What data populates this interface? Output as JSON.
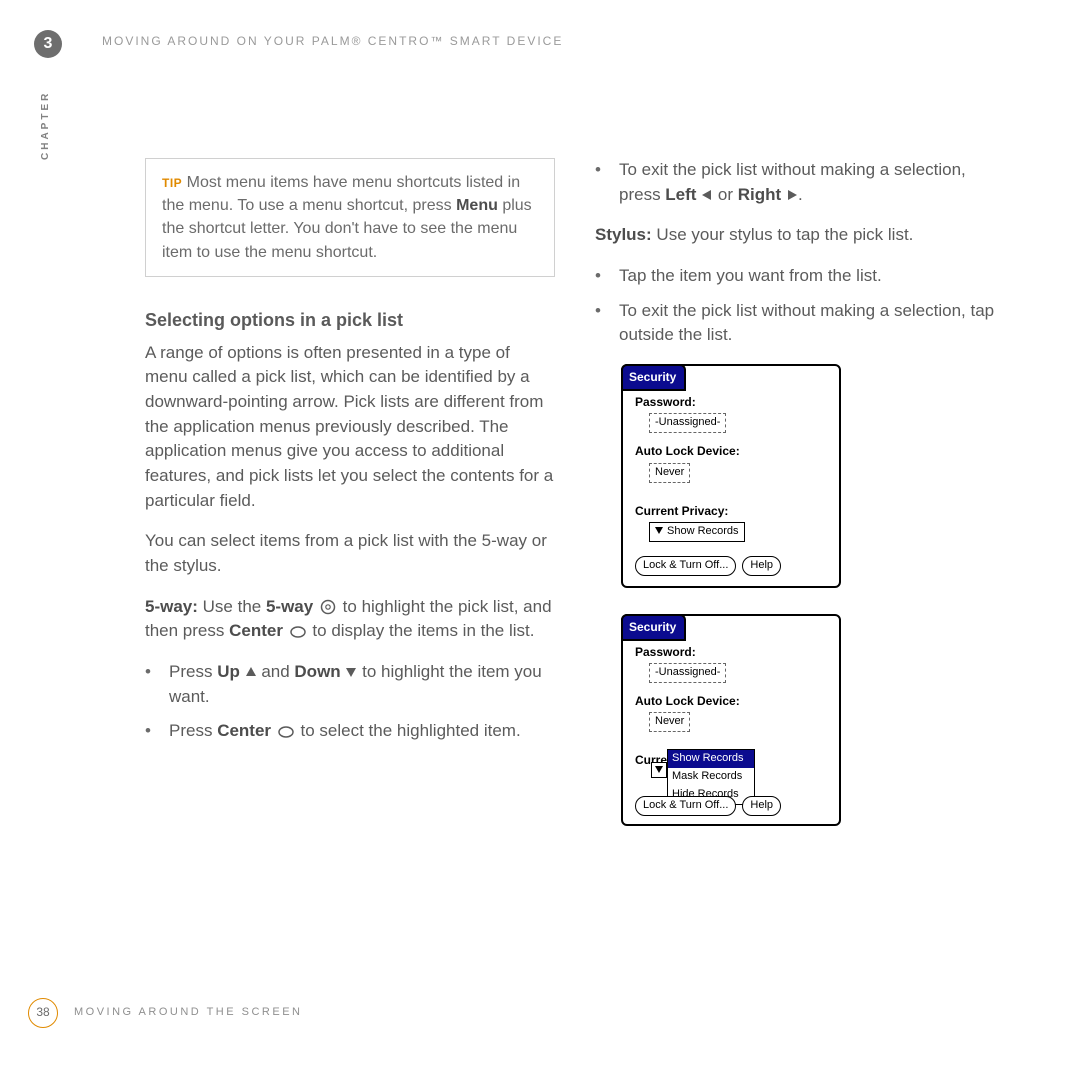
{
  "chapter": {
    "number": "3",
    "side_label": "CHAPTER"
  },
  "header": {
    "title": "MOVING AROUND ON YOUR PALM® CENTRO™ SMART DEVICE"
  },
  "tip": {
    "label": "TIP",
    "text": "Most menu items have menu shortcuts listed in the menu. To use a menu shortcut, press ",
    "bold1": "Menu",
    "text2": " plus the shortcut letter. You don't have to see the menu item to use the menu shortcut."
  },
  "left": {
    "heading": "Selecting options in a pick list",
    "para1": "A range of options is often presented in a type of menu called a pick list, which can be identified by a downward-pointing arrow. Pick lists are different from the application menus previously described. The application menus give you access to additional features, and pick lists let you select the contents for a particular field.",
    "para2": "You can select items from a pick list with the 5-way or the stylus.",
    "fiveway_lead": "5-way:",
    "fiveway_text1": " Use the ",
    "fiveway_bold1": "5-way",
    "fiveway_text2": " to highlight the pick list, and then press ",
    "fiveway_bold2": "Center",
    "fiveway_text3": " to display the items in the list.",
    "bullets": [
      {
        "pre": "Press ",
        "b1": "Up",
        "mid": " and ",
        "b2": "Down",
        "post": " to highlight the item you want."
      },
      {
        "pre": "Press ",
        "b1": "Center",
        "mid": "",
        "b2": "",
        "post": " to select the highlighted item."
      }
    ]
  },
  "right": {
    "bullet1_pre": "To exit the pick list without making a selection, press ",
    "bullet1_b1": "Left",
    "bullet1_mid": " or ",
    "bullet1_b2": "Right",
    "bullet1_post": ".",
    "stylus_lead": "Stylus:",
    "stylus_text": " Use your stylus to tap the pick list.",
    "bullet2": "Tap the item you want from the list.",
    "bullet3": "To exit the pick list without making a selection, tap outside the list."
  },
  "palm": {
    "tab": "Security",
    "password_label": "Password:",
    "password_value": "-Unassigned-",
    "autolock_label": "Auto Lock Device:",
    "autolock_value": "Never",
    "currentpriv_label": "Current Privacy:",
    "picklist_value": "Show Records",
    "button1": "Lock & Turn Off...",
    "button2": "Help",
    "dropdown": {
      "selected": "Show Records",
      "option2": "Mask Records",
      "option3": "Hide Records"
    },
    "curre": "Curre"
  },
  "footer": {
    "page": "38",
    "title": "MOVING AROUND THE SCREEN"
  }
}
